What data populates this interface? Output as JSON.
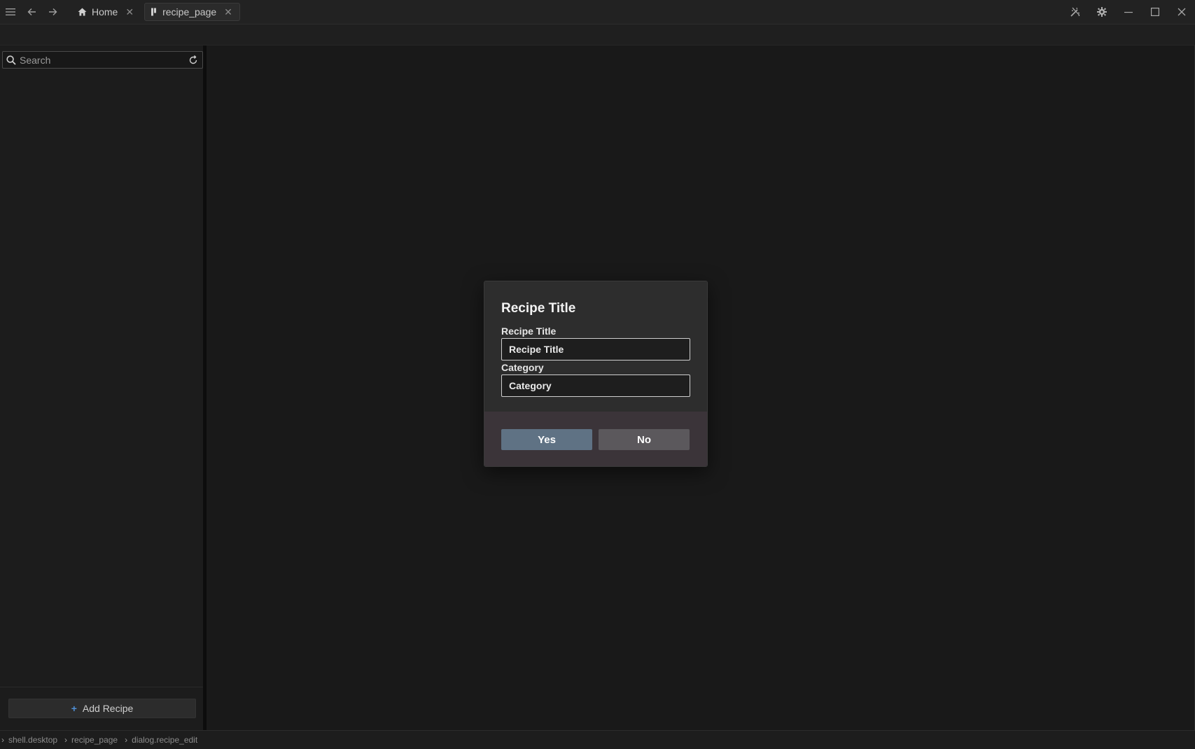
{
  "titlebar": {
    "tabs": [
      {
        "label": "Home",
        "icon": "home-icon",
        "active": false
      },
      {
        "label": "recipe_page",
        "icon": "page-icon",
        "active": true
      }
    ],
    "close_glyph": "✕"
  },
  "sidebar": {
    "search": {
      "placeholder": "Search",
      "value": ""
    },
    "add_button": {
      "label": "Add Recipe"
    }
  },
  "dialog": {
    "title": "Recipe Title",
    "fields": [
      {
        "label": "Recipe Title",
        "placeholder": "Recipe Title"
      },
      {
        "label": "Category",
        "placeholder": "Category"
      }
    ],
    "yes_label": "Yes",
    "no_label": "No"
  },
  "statusbar": {
    "crumbs": [
      "shell.desktop",
      "recipe_page",
      "dialog.recipe_edit"
    ]
  },
  "colors": {
    "background": "#1a1a1a",
    "dialog_body": "#2d2d2d",
    "dialog_footer": "#3b3439",
    "yes_button": "#5f7284",
    "no_button": "#5b585c",
    "accent": "#4f8fd6"
  }
}
